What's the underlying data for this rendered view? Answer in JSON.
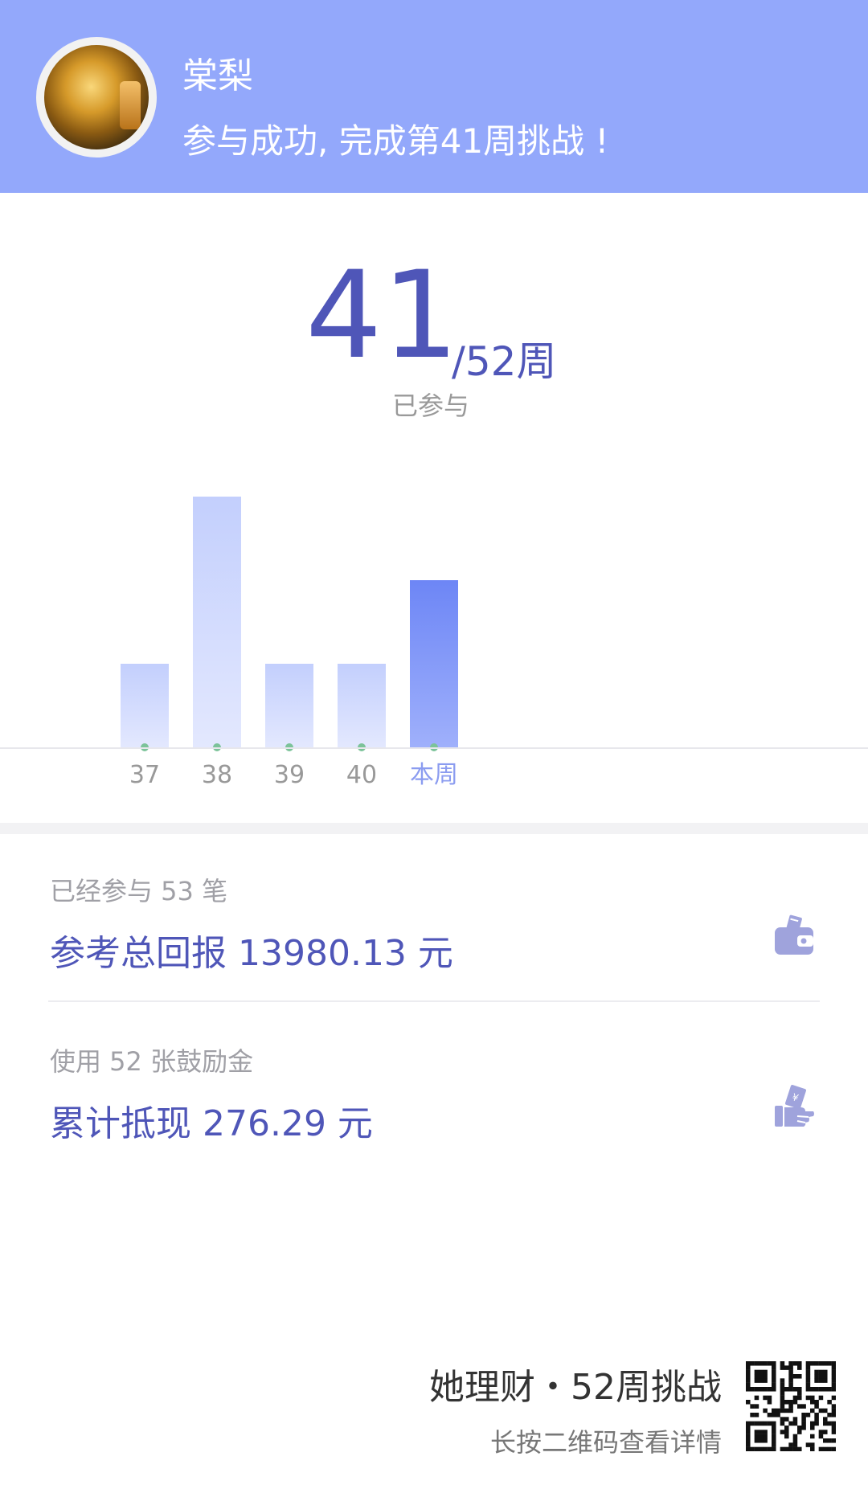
{
  "header": {
    "user_name": "棠梨",
    "message": "参与成功, 完成第41周挑战 !"
  },
  "summary": {
    "count": "41",
    "suffix": "/52周",
    "label": "已参与"
  },
  "chart_data": {
    "type": "bar",
    "categories": [
      "37",
      "38",
      "39",
      "40",
      "本周"
    ],
    "values": [
      1,
      3,
      1,
      1,
      2
    ],
    "highlight_index": 4,
    "colors": {
      "bar": "#c3cffd",
      "bar_light": "#e3e8fe",
      "highlight": "#6d86f6",
      "highlight_light": "#9fb0fb",
      "dot": "#7cc39a",
      "label": "#999999",
      "label_highlight": "#8b9cf0"
    }
  },
  "stats": [
    {
      "label": "已经参与 53 笔",
      "value": "参考总回报 13980.13 元",
      "icon": "wallet-icon"
    },
    {
      "label": "使用 52 张鼓励金",
      "value": "累计抵现 276.29 元",
      "icon": "cash-in-hand-icon"
    }
  ],
  "footer": {
    "brand": "她理财・52周挑战",
    "hint": "长按二维码查看详情",
    "qr_icon": "qr-code-icon"
  },
  "colors": {
    "header_bg": "#93a8fb",
    "accent": "#4f56b8",
    "icon": "#9fa3dc"
  }
}
